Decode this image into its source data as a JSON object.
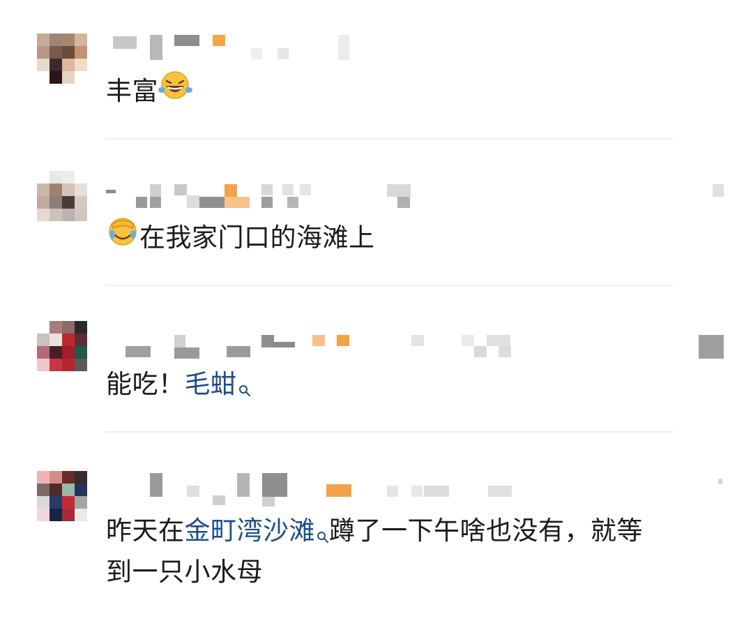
{
  "comments": [
    {
      "text_before_emoji": "丰富",
      "emoji": "laughing-tears-emoji"
    },
    {
      "emoji": "face-palm-tears-emoji",
      "text": "在我家门口的海滩上"
    },
    {
      "text": "能吃！",
      "link": "毛蚶",
      "link_icon": "search-icon"
    },
    {
      "line1_before": "昨天在",
      "link": "金町湾沙滩",
      "link_icon": "search-icon",
      "line1_after": "蹲了一下午啥也没有，就等",
      "line2": "到一只小水母"
    }
  ]
}
